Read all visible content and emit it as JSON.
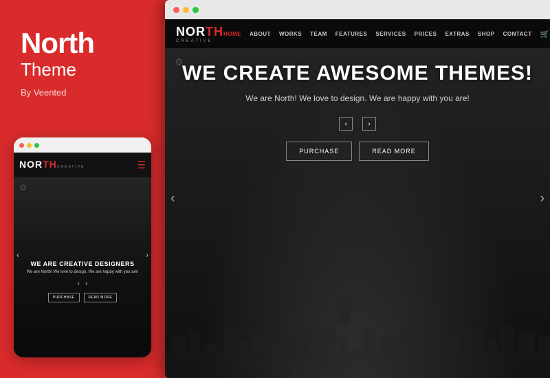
{
  "left": {
    "title": "North",
    "subtitle": "Theme",
    "by": "By Veented"
  },
  "mobile": {
    "logo_nor": "NOR",
    "logo_th": "TH",
    "logo_creative": "CREATIVE",
    "hero_heading": "WE ARE CREATIVE DESIGNERS",
    "hero_sub": "We are North! We love to design. We are happy with you are!",
    "btn_purchase": "PURCHASE",
    "btn_read_more": "READ MORE"
  },
  "desktop": {
    "logo_nor": "NOR",
    "logo_th": "TH",
    "logo_creative": "CREATIVE",
    "nav_links": [
      "HOME",
      "ABOUT",
      "WORKS",
      "TEAM",
      "FEATURES",
      "SERVICES",
      "PRICES",
      "EXTRAS",
      "SHOP",
      "CONTACT"
    ],
    "hero_heading": "WE CREATE AWESOME THEMES!",
    "hero_sub": "We are North! We love to design. We are happy with you are!",
    "btn_purchase": "PURCHASE",
    "btn_read_more": "READ MORE"
  }
}
